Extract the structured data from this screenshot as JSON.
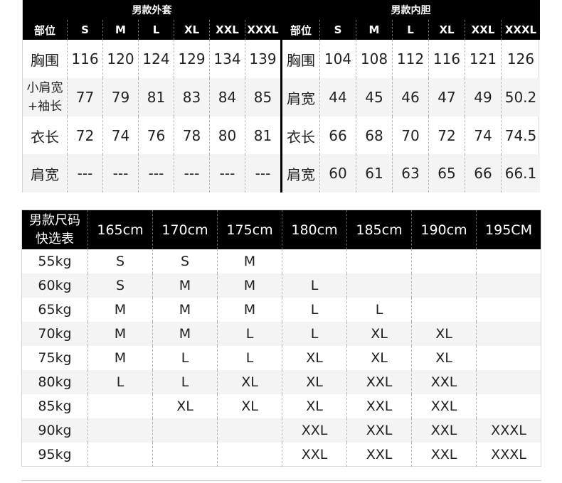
{
  "outerwear": {
    "title": "男款外套",
    "header": [
      "部位",
      "S",
      "M",
      "L",
      "XL",
      "XXL",
      "XXXL"
    ],
    "rows": [
      [
        "胸围",
        "116",
        "120",
        "124",
        "129",
        "134",
        "139"
      ],
      [
        "小肩宽\n+袖长",
        "77",
        "79",
        "81",
        "83",
        "84",
        "85"
      ],
      [
        "衣长",
        "72",
        "74",
        "76",
        "78",
        "80",
        "81"
      ],
      [
        "肩宽",
        "---",
        "---",
        "---",
        "---",
        "---",
        "---"
      ]
    ]
  },
  "liner": {
    "title": "男款内胆",
    "header": [
      "部位",
      "S",
      "M",
      "L",
      "XL",
      "XXL",
      "XXXL"
    ],
    "rows": [
      [
        "胸围",
        "104",
        "108",
        "112",
        "116",
        "121",
        "126"
      ],
      [
        "肩宽",
        "44",
        "45",
        "46",
        "47",
        "49",
        "50.2"
      ],
      [
        "衣长",
        "66",
        "68",
        "70",
        "72",
        "74",
        "74.5"
      ],
      [
        "肩宽",
        "60",
        "61",
        "63",
        "65",
        "66",
        "66.1"
      ]
    ]
  },
  "quick_size": {
    "corner": "男款尺码\n快选表",
    "heights": [
      "165cm",
      "170cm",
      "175cm",
      "180cm",
      "185cm",
      "190cm",
      "195CM"
    ],
    "rows": [
      [
        "55kg",
        "S",
        "S",
        "M",
        "",
        "",
        "",
        ""
      ],
      [
        "60kg",
        "S",
        "M",
        "M",
        "L",
        "",
        "",
        ""
      ],
      [
        "65kg",
        "M",
        "M",
        "M",
        "L",
        "L",
        "",
        ""
      ],
      [
        "70kg",
        "M",
        "M",
        "L",
        "L",
        "XL",
        "XL",
        ""
      ],
      [
        "75kg",
        "M",
        "L",
        "L",
        "XL",
        "XL",
        "XL",
        ""
      ],
      [
        "80kg",
        "L",
        "L",
        "XL",
        "XL",
        "XXL",
        "XXL",
        ""
      ],
      [
        "85kg",
        "",
        "XL",
        "XL",
        "XL",
        "XXL",
        "XXL",
        ""
      ],
      [
        "90kg",
        "",
        "",
        "",
        "XXL",
        "XXL",
        "XXL",
        "XXXL"
      ],
      [
        "95kg",
        "",
        "",
        "",
        "XXL",
        "XXL",
        "XXL",
        "XXXL"
      ]
    ]
  }
}
